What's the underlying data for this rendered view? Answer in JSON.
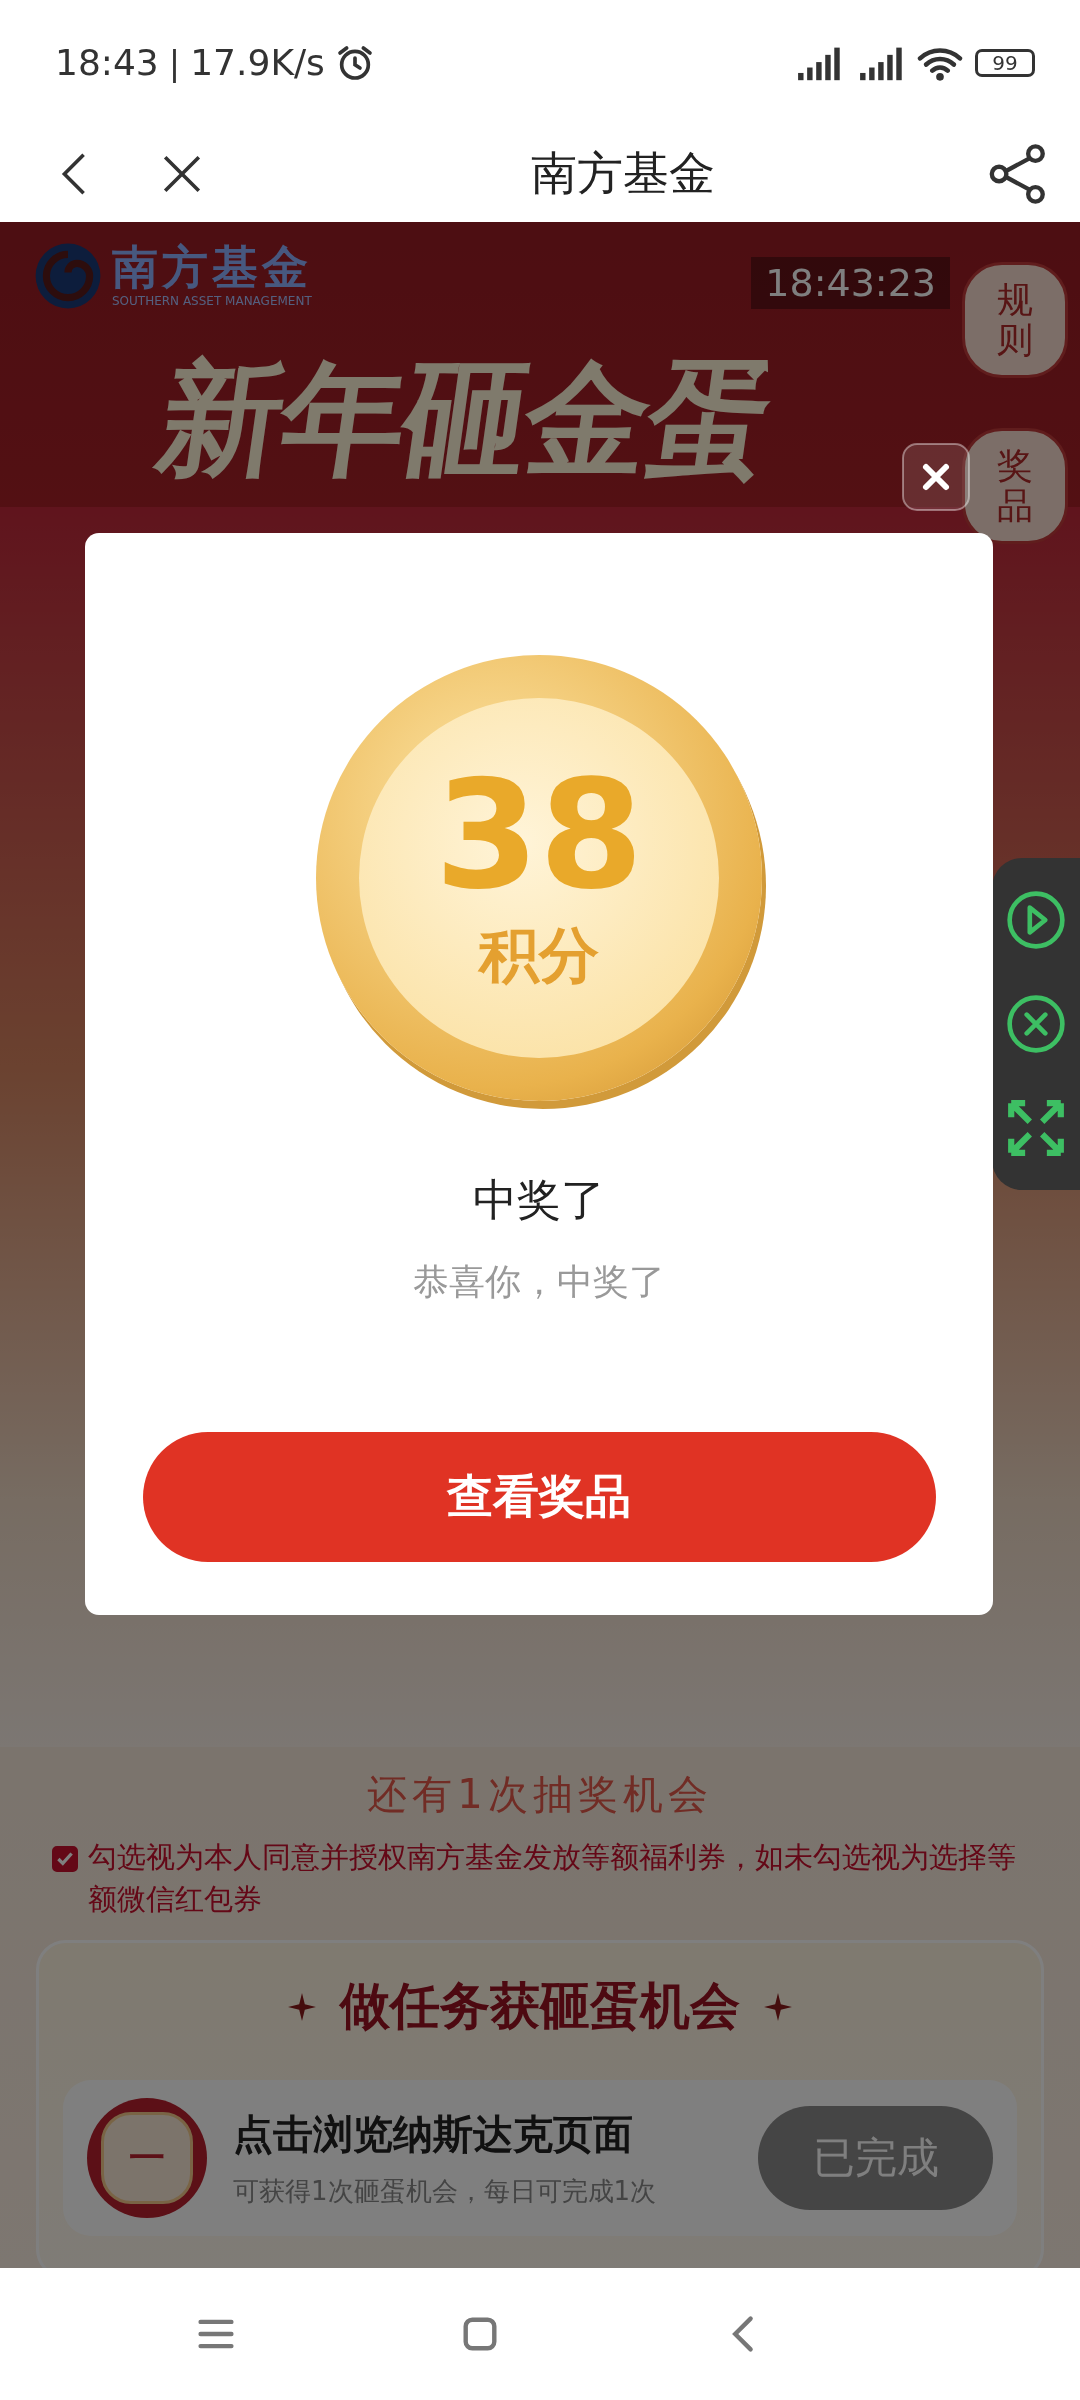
{
  "status_bar": {
    "time": "18:43",
    "separator": "|",
    "speed": "17.9K/s",
    "battery": "99"
  },
  "nav_bar": {
    "title": "南方基金"
  },
  "page": {
    "logo_text": "南方基金",
    "logo_subtitle": "SOUTHERN ASSET MANAGEMENT",
    "clock": "18:43:23",
    "side_tags": [
      "规则",
      "奖品"
    ],
    "banner_title": "新年砸金蛋",
    "chances": "还有1次抽奖机会",
    "consent": {
      "checked": true,
      "text": "勾选视为本人同意并授权南方基金发放等额福利券，如未勾选视为选择等额微信红包券"
    },
    "tasks_card": {
      "title": "做任务获砸蛋机会",
      "tasks": [
        {
          "badge_text": "一",
          "title": "点击浏览纳斯达克页面",
          "subtitle": "可获得1次砸蛋机会，每日可完成1次",
          "button": "已完成",
          "done": true
        }
      ]
    }
  },
  "dialog": {
    "coin_value": "38",
    "coin_unit": "积分",
    "title": "中奖了",
    "message": "恭喜你，中奖了",
    "button": "查看奖品"
  }
}
